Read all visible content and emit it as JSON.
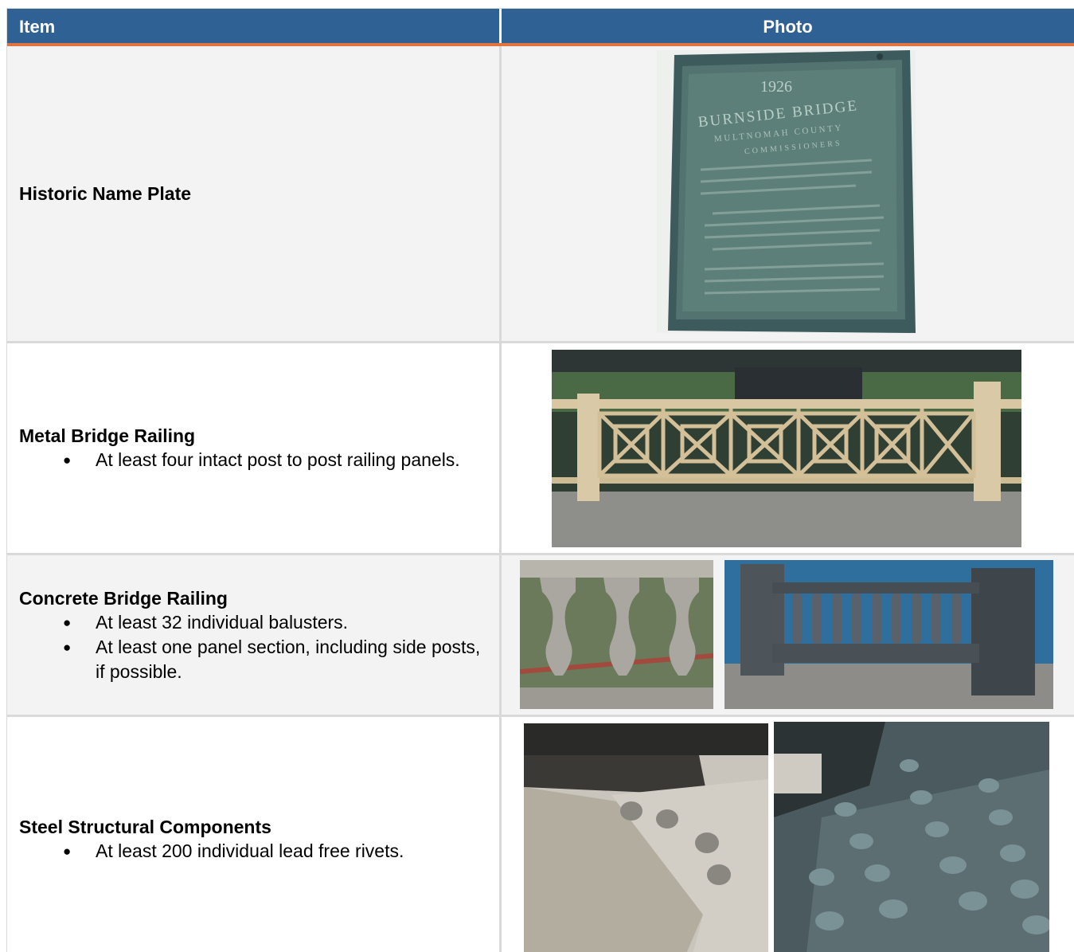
{
  "header": {
    "item": "Item",
    "photo": "Photo"
  },
  "rows": [
    {
      "title": "Historic Name Plate",
      "bullets": []
    },
    {
      "title": "Metal Bridge Railing",
      "bullets": [
        "At least four intact post to post railing panels."
      ]
    },
    {
      "title": "Concrete Bridge Railing",
      "bullets": [
        "At least 32 individual balusters.",
        "At least one panel section, including side posts, if possible."
      ]
    },
    {
      "title": "Steel Structural Components",
      "bullets": [
        "At least 200 individual lead free rivets."
      ]
    }
  ],
  "plaque": {
    "year": "1926",
    "line1": "BURNSIDE BRIDGE",
    "line2": "MULTNOMAH COUNTY",
    "line3": "COMMISSIONERS"
  },
  "colors": {
    "header_bg": "#2f6195",
    "header_accent": "#e0733f",
    "row_shade": "#f3f3f3",
    "grid": "#d9d9d9"
  },
  "icons": {
    "bullet": "filled-circle-bullet"
  }
}
